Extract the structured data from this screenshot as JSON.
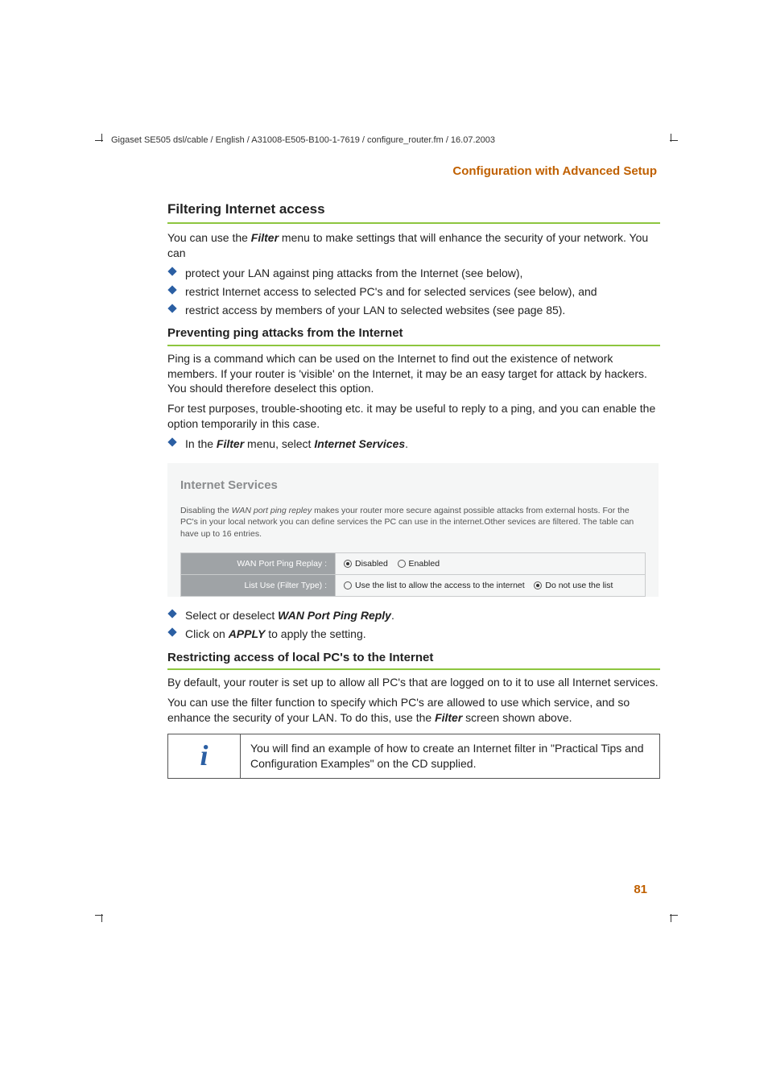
{
  "path_line": "Gigaset SE505 dsl/cable / English / A31008-E505-B100-1-7619 / configure_router.fm / 16.07.2003",
  "section_header": "Configuration with Advanced Setup",
  "h2": "Filtering Internet access",
  "intro_1a": "You can use the ",
  "intro_1_filter": "Filter",
  "intro_1b": " menu to make settings that will enhance the security of your network. You can",
  "bullets1": {
    "b1": "protect your LAN against ping attacks from the Internet (see below),",
    "b2": "restrict Internet access to selected PC's and for selected services (see below), and",
    "b3": "restrict access by members of your LAN to selected websites (see page 85)."
  },
  "h3a": "Preventing ping attacks from the Internet",
  "para_a1": "Ping is a command which can be used on the Internet to find out the existence of network members. If your router is 'visible' on the Internet, it may be an easy target for attack by hackers. You should therefore deselect this option.",
  "para_a2": "For test purposes, trouble-shooting etc. it may be useful to reply to a ping, and you can enable the option temporarily in this case.",
  "bullets2": {
    "b1a": "In the ",
    "b1_filter": "Filter",
    "b1b": " menu, select ",
    "b1_is": "Internet Services",
    "b1c": "."
  },
  "ss": {
    "title": "Internet Services",
    "desc_a": "Disabling the ",
    "desc_em": "WAN port ping repley",
    "desc_b": " makes your router more secure against possible attacks from external hosts. For the PC's in your local network you can define services the PC can use in the internet.Other sevices are filtered. The table can have up to 16 entries.",
    "row1": {
      "label": "WAN Port Ping Replay :",
      "opt1": "Disabled",
      "opt2": "Enabled",
      "selected": 1
    },
    "row2": {
      "label": "List Use (Filter Type) :",
      "opt1": "Use the list to allow the access to the internet",
      "opt2": "Do not use the list",
      "selected": 2
    }
  },
  "bullets3": {
    "b1a": "Select or deselect ",
    "b1_bold": "WAN Port Ping Reply",
    "b1b": ".",
    "b2a": "Click on ",
    "b2_bold": "APPLY",
    "b2b": " to apply the setting."
  },
  "h3b": "Restricting access of local PC's to the Internet",
  "para_b1": "By default, your router is set up to allow all PC's that are logged on to it to use all Internet services.",
  "para_b2a": "You can use the filter function to specify which PC's are allowed to use which service, and so enhance the security of your LAN. To do this, use the ",
  "para_b2_filter": "Filter",
  "para_b2b": " screen shown above.",
  "note": "You will find an example of how to create an Internet filter in \"Practical Tips and Configuration Examples\" on the CD supplied.",
  "page_num": "81",
  "info_symbol": "i"
}
